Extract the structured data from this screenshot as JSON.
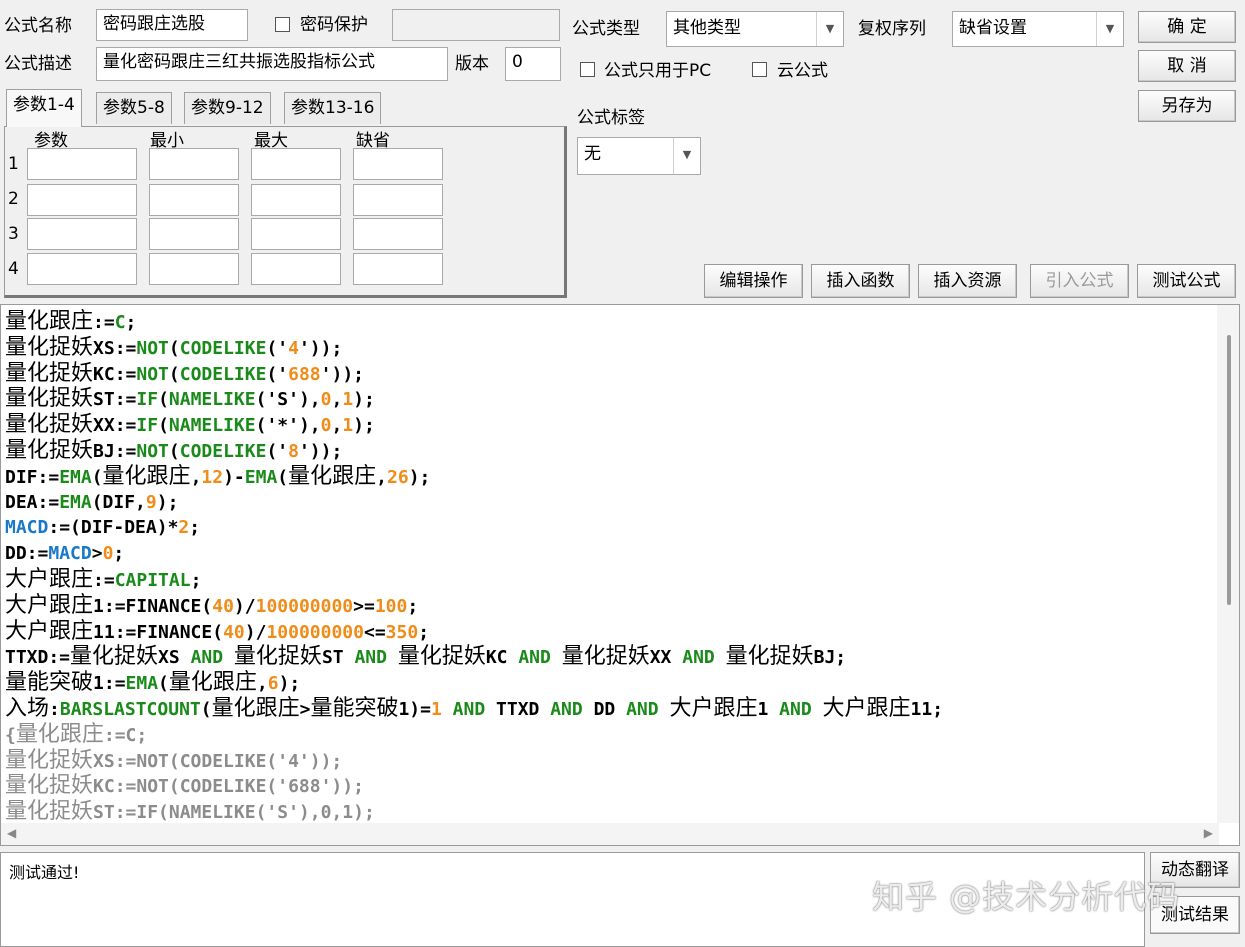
{
  "formula_name": {
    "label": "公式名称",
    "value": "密码跟庄选股"
  },
  "password_protect": {
    "label": "密码保护",
    "checked": false,
    "value": ""
  },
  "formula_desc": {
    "label": "公式描述",
    "value": "量化密码跟庄三红共振选股指标公式"
  },
  "version": {
    "label": "版本",
    "value": "0"
  },
  "formula_type": {
    "label": "公式类型",
    "value": "其他类型"
  },
  "rights_seq": {
    "label": "复权序列",
    "value": "缺省设置"
  },
  "pc_only": {
    "label": "公式只用于PC",
    "checked": false
  },
  "cloud": {
    "label": "云公式",
    "checked": false
  },
  "formula_tag": {
    "label": "公式标签",
    "value": "无"
  },
  "buttons": {
    "ok": "确  定",
    "cancel": "取  消",
    "save_as": "另存为",
    "edit_ops": "编辑操作",
    "insert_func": "插入函数",
    "insert_res": "插入资源",
    "import_formula": "引入公式",
    "test_formula": "测试公式",
    "dynamic_translate": "动态翻译",
    "test_result": "测试结果"
  },
  "param_tabs": [
    "参数1-4",
    "参数5-8",
    "参数9-12",
    "参数13-16"
  ],
  "param_headers": [
    "参数",
    "最小",
    "最大",
    "缺省"
  ],
  "param_rows": [
    "1",
    "2",
    "3",
    "4"
  ],
  "code_lines": [
    [
      [
        "cjk",
        "量化跟庄"
      ],
      [
        "t",
        ":="
      ],
      [
        "kw",
        "C"
      ],
      [
        "t",
        ";"
      ]
    ],
    [
      [
        "cjk",
        "量化捉妖"
      ],
      [
        "t",
        "XS:="
      ],
      [
        "kw",
        "NOT"
      ],
      [
        "t",
        "("
      ],
      [
        "kw",
        "CODELIKE"
      ],
      [
        "t",
        "('"
      ],
      [
        "num",
        "4"
      ],
      [
        "t",
        "'));"
      ]
    ],
    [
      [
        "cjk",
        "量化捉妖"
      ],
      [
        "t",
        "KC:="
      ],
      [
        "kw",
        "NOT"
      ],
      [
        "t",
        "("
      ],
      [
        "kw",
        "CODELIKE"
      ],
      [
        "t",
        "('"
      ],
      [
        "num",
        "688"
      ],
      [
        "t",
        "'));"
      ]
    ],
    [
      [
        "cjk",
        "量化捉妖"
      ],
      [
        "t",
        "ST:="
      ],
      [
        "kw",
        "IF"
      ],
      [
        "t",
        "("
      ],
      [
        "kw",
        "NAMELIKE"
      ],
      [
        "t",
        "('S'),"
      ],
      [
        "num",
        "0"
      ],
      [
        "t",
        ","
      ],
      [
        "num",
        "1"
      ],
      [
        "t",
        ");"
      ]
    ],
    [
      [
        "cjk",
        "量化捉妖"
      ],
      [
        "t",
        "XX:="
      ],
      [
        "kw",
        "IF"
      ],
      [
        "t",
        "("
      ],
      [
        "kw",
        "NAMELIKE"
      ],
      [
        "t",
        "('*'),"
      ],
      [
        "num",
        "0"
      ],
      [
        "t",
        ","
      ],
      [
        "num",
        "1"
      ],
      [
        "t",
        ");"
      ]
    ],
    [
      [
        "cjk",
        "量化捉妖"
      ],
      [
        "t",
        "BJ:="
      ],
      [
        "kw",
        "NOT"
      ],
      [
        "t",
        "("
      ],
      [
        "kw",
        "CODELIKE"
      ],
      [
        "t",
        "('"
      ],
      [
        "num",
        "8"
      ],
      [
        "t",
        "'));"
      ]
    ],
    [
      [
        "t",
        "DIF:="
      ],
      [
        "kw",
        "EMA"
      ],
      [
        "t",
        "("
      ],
      [
        "cjk",
        "量化跟庄"
      ],
      [
        "t",
        ","
      ],
      [
        "num",
        "12"
      ],
      [
        "t",
        ")-"
      ],
      [
        "kw",
        "EMA"
      ],
      [
        "t",
        "("
      ],
      [
        "cjk",
        "量化跟庄"
      ],
      [
        "t",
        ","
      ],
      [
        "num",
        "26"
      ],
      [
        "t",
        ");"
      ]
    ],
    [
      [
        "t",
        "DEA:="
      ],
      [
        "kw",
        "EMA"
      ],
      [
        "t",
        "(DIF,"
      ],
      [
        "num",
        "9"
      ],
      [
        "t",
        ");"
      ]
    ],
    [
      [
        "var",
        "MACD"
      ],
      [
        "t",
        ":=(DIF-DEA)*"
      ],
      [
        "num",
        "2"
      ],
      [
        "t",
        ";"
      ]
    ],
    [
      [
        "t",
        "DD:="
      ],
      [
        "var",
        "MACD"
      ],
      [
        "t",
        ">"
      ],
      [
        "num",
        "0"
      ],
      [
        "t",
        ";"
      ]
    ],
    [
      [
        "cjk",
        "大户跟庄"
      ],
      [
        "t",
        ":="
      ],
      [
        "kw",
        "CAPITAL"
      ],
      [
        "t",
        ";"
      ]
    ],
    [
      [
        "cjk",
        "大户跟庄"
      ],
      [
        "t",
        "1:=FINANCE("
      ],
      [
        "num",
        "40"
      ],
      [
        "t",
        ")/"
      ],
      [
        "num",
        "100000000"
      ],
      [
        "t",
        ">="
      ],
      [
        "num",
        "100"
      ],
      [
        "t",
        ";"
      ]
    ],
    [
      [
        "cjk",
        "大户跟庄"
      ],
      [
        "t",
        "11:=FINANCE("
      ],
      [
        "num",
        "40"
      ],
      [
        "t",
        ")/"
      ],
      [
        "num",
        "100000000"
      ],
      [
        "t",
        "<="
      ],
      [
        "num",
        "350"
      ],
      [
        "t",
        ";"
      ]
    ],
    [
      [
        "t",
        "TTXD:="
      ],
      [
        "cjk",
        "量化捉妖"
      ],
      [
        "t",
        "XS "
      ],
      [
        "kw",
        "AND"
      ],
      [
        "t",
        " "
      ],
      [
        "cjk",
        "量化捉妖"
      ],
      [
        "t",
        "ST "
      ],
      [
        "kw",
        "AND"
      ],
      [
        "t",
        " "
      ],
      [
        "cjk",
        "量化捉妖"
      ],
      [
        "t",
        "KC "
      ],
      [
        "kw",
        "AND"
      ],
      [
        "t",
        " "
      ],
      [
        "cjk",
        "量化捉妖"
      ],
      [
        "t",
        "XX "
      ],
      [
        "kw",
        "AND"
      ],
      [
        "t",
        " "
      ],
      [
        "cjk",
        "量化捉妖"
      ],
      [
        "t",
        "BJ;"
      ]
    ],
    [
      [
        "cjk",
        "量能突破"
      ],
      [
        "t",
        "1:="
      ],
      [
        "kw",
        "EMA"
      ],
      [
        "t",
        "("
      ],
      [
        "cjk",
        "量化跟庄"
      ],
      [
        "t",
        ","
      ],
      [
        "num",
        "6"
      ],
      [
        "t",
        ");"
      ]
    ],
    [
      [
        "cjk",
        "入场"
      ],
      [
        "t",
        ":"
      ],
      [
        "kw",
        "BARSLASTCOUNT"
      ],
      [
        "t",
        "("
      ],
      [
        "cjk",
        "量化跟庄"
      ],
      [
        "t",
        ">"
      ],
      [
        "cjk",
        "量能突破"
      ],
      [
        "t",
        "1)="
      ],
      [
        "num",
        "1"
      ],
      [
        "t",
        " "
      ],
      [
        "kw",
        "AND"
      ],
      [
        "t",
        " TTXD "
      ],
      [
        "kw",
        "AND"
      ],
      [
        "t",
        " DD "
      ],
      [
        "kw",
        "AND"
      ],
      [
        "t",
        " "
      ],
      [
        "cjk",
        "大户跟庄"
      ],
      [
        "t",
        "1 "
      ],
      [
        "kw",
        "AND"
      ],
      [
        "t",
        " "
      ],
      [
        "cjk",
        "大户跟庄"
      ],
      [
        "t",
        "11;"
      ]
    ],
    [
      [
        "c",
        "{"
      ],
      [
        "ccjk",
        "量化跟庄"
      ],
      [
        "c",
        ":=C;"
      ]
    ],
    [
      [
        "ccjk",
        "量化捉妖"
      ],
      [
        "c",
        "XS:=NOT(CODELIKE('4'));"
      ]
    ],
    [
      [
        "ccjk",
        "量化捉妖"
      ],
      [
        "c",
        "KC:=NOT(CODELIKE('688'));"
      ]
    ],
    [
      [
        "ccjk",
        "量化捉妖"
      ],
      [
        "c",
        "ST:=IF(NAMELIKE('S'),0,1);"
      ]
    ]
  ],
  "result_text": "测试通过!",
  "watermark": "知乎 @技术分析代码"
}
